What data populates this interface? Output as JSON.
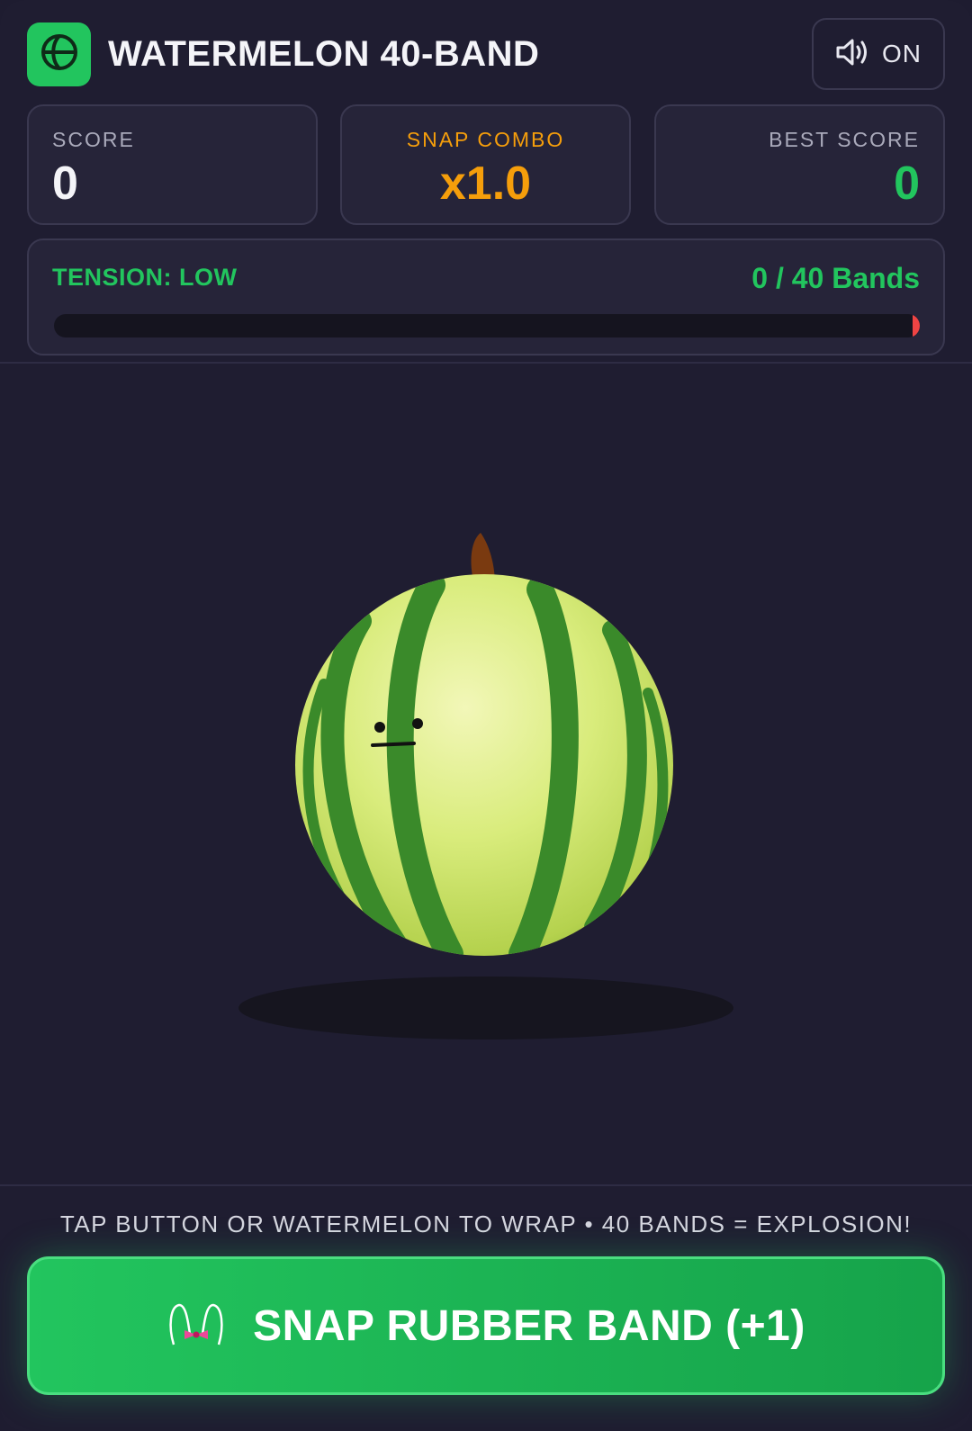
{
  "header": {
    "title": "WATERMELON 40-BAND",
    "logo_icon": "watermelon-slice-icon",
    "sound": {
      "icon": "speaker-volume-icon",
      "label": "ON"
    }
  },
  "stats": {
    "score": {
      "label": "SCORE",
      "value": "0"
    },
    "combo": {
      "label": "SNAP COMBO",
      "value": "x1.0"
    },
    "best": {
      "label": "BEST SCORE",
      "value": "0"
    }
  },
  "tension": {
    "label": "TENSION: LOW",
    "count_text": "0 / 40 Bands",
    "bands": 0,
    "max_bands": 40
  },
  "hint": "TAP BUTTON OR WATERMELON TO WRAP • 40 BANDS = EXPLOSION!",
  "action": {
    "label": "SNAP RUBBER BAND (+1)",
    "icon": "rubber-band-icon"
  },
  "colors": {
    "accent": "#22c55e",
    "combo": "#f59e0b",
    "danger": "#ef4444",
    "background": "#1f1d31"
  }
}
